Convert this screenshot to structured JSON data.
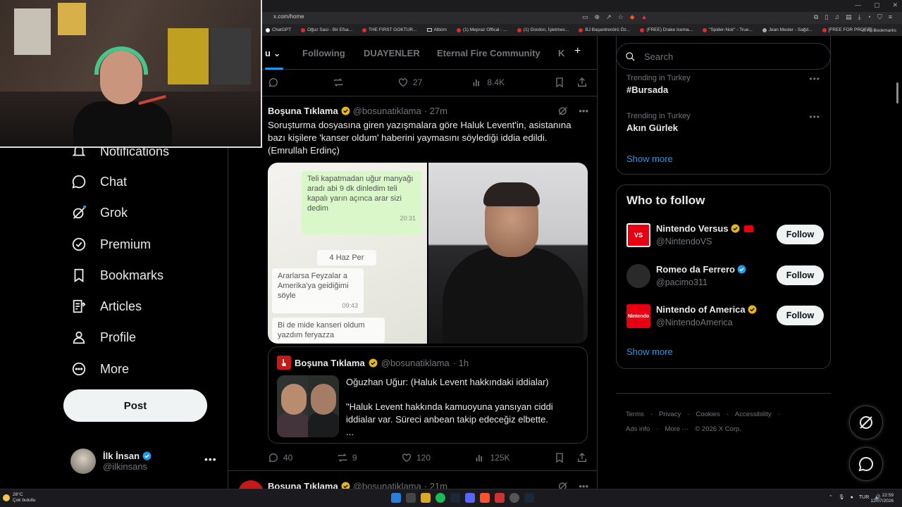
{
  "browser": {
    "url": "x.com/home",
    "bookmarks": [
      "ChatGPT",
      "Oğuz Sasi - Bir Efsa...",
      "THE FIRST GOKTUR...",
      "Albüm",
      "(1) Mepraz Offical - ...",
      "(1) Gordon, İşletmec...",
      "BJ Başantrenörü Öz...",
      "(FREE) Drake Icema...",
      "\"Spider-Noir\" - True...",
      "Jean Mesler - Sağd...",
      "[FREE FOR PROFIT]..."
    ],
    "all_bookmarks": "All Bookmarks"
  },
  "nav": {
    "items": [
      {
        "label": "Notifications",
        "icon": "bell-icon"
      },
      {
        "label": "Chat",
        "icon": "chat-bubble-icon"
      },
      {
        "label": "Grok",
        "icon": "grok-icon"
      },
      {
        "label": "Premium",
        "icon": "verified-badge-icon"
      },
      {
        "label": "Bookmarks",
        "icon": "bookmark-icon"
      },
      {
        "label": "Articles",
        "icon": "article-icon"
      },
      {
        "label": "Profile",
        "icon": "person-icon"
      },
      {
        "label": "More",
        "icon": "more-circle-icon"
      }
    ],
    "post_label": "Post",
    "account": {
      "name": "İlk İnsan",
      "handle": "@ilkinsans"
    }
  },
  "feed": {
    "tabs": [
      {
        "label": "u",
        "active": true
      },
      {
        "label": "Following",
        "active": false
      },
      {
        "label": "DUAYENLER",
        "active": false
      },
      {
        "label": "Eternal Fire Community",
        "active": false
      },
      {
        "label": "K",
        "active": false
      }
    ],
    "prev_actions": {
      "replies": "",
      "reposts": "",
      "likes": "27",
      "views": "8.4K"
    },
    "tweet": {
      "name": "Boşuna Tıklama",
      "handle": "@bosunatiklama",
      "time": "· 27m",
      "text": "Soruşturma dosyasına giren yazışmalara göre Haluk Levent'in, asistanına bazı kişilere 'kanser oldum' haberini yaymasını söylediği iddia edildi. (Emrullah Erdinç)",
      "chat_lines": [
        "Teli kapatmadan uğur manyağı aradı abi 9 dk dinledim teli kapalı yarın açınca arar sizi dedim",
        "20:31",
        "4 Haz Per",
        "Ararlarsa Feyzalar a Amerika'ya geidiğimi söyle",
        "09:43",
        "Bi de mide kanseri oldum yazdım feryazza"
      ],
      "quote": {
        "name": "Boşuna Tıklama",
        "handle": "@bosunatiklama",
        "time": "· 1h",
        "title": "Oğuzhan Uğur: (Haluk Levent hakkındaki iddialar)",
        "body": "\"Haluk Levent hakkında kamuoyuna yansıyan ciddi iddialar var. Süreci anbean takip edeceğiz elbette.",
        "ellipsis": "..."
      },
      "actions": {
        "replies": "40",
        "reposts": "9",
        "likes": "120",
        "views": "125K"
      }
    },
    "next_tweet": {
      "name": "Boşuna Tıklama",
      "handle": "@bosunatiklama",
      "time": "· 21m"
    }
  },
  "sidebar": {
    "search_placeholder": "Search",
    "trends": [
      {
        "category": "Trending in Turkey",
        "name": "#Bursada"
      },
      {
        "category": "Trending in Turkey",
        "name": "Akın Gürlek"
      }
    ],
    "show_more": "Show more",
    "who_to_follow": {
      "title": "Who to follow",
      "accounts": [
        {
          "name": "Nintendo Versus",
          "handle": "@NintendoVS",
          "badge": "gold",
          "avatar_text": "VS",
          "avatar_color": "#e60012"
        },
        {
          "name": "Romeo da Ferrero",
          "handle": "@pacimo311",
          "badge": "blue",
          "avatar_text": "",
          "avatar_color": "#2a2a2a"
        },
        {
          "name": "Nintendo of America",
          "handle": "@NintendoAmerica",
          "badge": "gold",
          "avatar_text": "Nintendo",
          "avatar_color": "#e60012"
        }
      ],
      "follow_label": "Follow",
      "show_more": "Show more"
    },
    "footer": [
      "Terms",
      "·",
      "Privacy",
      "·",
      "Cookies",
      "·",
      "Accessibility",
      "·",
      "Ads info",
      "·",
      "More ···",
      "© 2026 X Corp."
    ]
  },
  "taskbar": {
    "temperature": "28°C",
    "weather": "Çok bulutlu",
    "lang": "TUR",
    "time": "22:59",
    "date": "12/07/2026"
  },
  "colors": {
    "accent": "#1d9bf0",
    "border": "#2f3336",
    "muted": "#71767b",
    "gold": "#e2b719"
  }
}
